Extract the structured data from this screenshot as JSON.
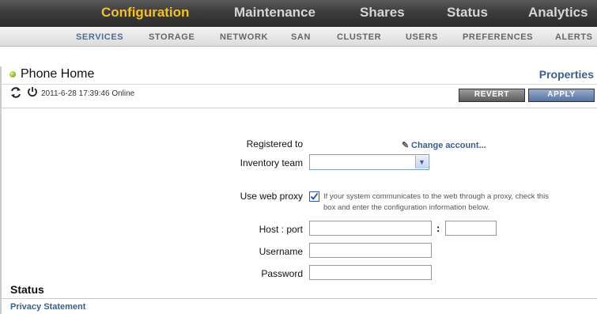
{
  "top_nav": {
    "items": [
      {
        "label": "Configuration",
        "active": true
      },
      {
        "label": "Maintenance",
        "active": false
      },
      {
        "label": "Shares",
        "active": false
      },
      {
        "label": "Status",
        "active": false
      },
      {
        "label": "Analytics",
        "active": false
      }
    ]
  },
  "sub_nav": {
    "items": [
      {
        "label": "SERVICES",
        "active": true
      },
      {
        "label": "STORAGE",
        "active": false
      },
      {
        "label": "NETWORK",
        "active": false
      },
      {
        "label": "SAN",
        "active": false
      },
      {
        "label": "CLUSTER",
        "active": false
      },
      {
        "label": "USERS",
        "active": false
      },
      {
        "label": "PREFERENCES",
        "active": false
      },
      {
        "label": "ALERTS",
        "active": false
      }
    ]
  },
  "page": {
    "title": "Phone Home",
    "properties_link": "Properties",
    "status_info": "2011-6-28 17:39:46 Online",
    "revert_label": "REVERT",
    "apply_label": "APPLY"
  },
  "form": {
    "registered_label": "Registered to",
    "change_account_label": "Change account...",
    "inventory_label": "Inventory team",
    "inventory_value": "",
    "web_proxy_label": "Use web proxy",
    "web_proxy_checked": true,
    "web_proxy_description": "If your system communicates to the web through a proxy, check this box and enter the configuration information below.",
    "host_port_label": "Host : port",
    "host_value": "",
    "port_separator": ":",
    "port_value": "",
    "username_label": "Username",
    "username_value": "",
    "password_label": "Password",
    "password_value": ""
  },
  "footer": {
    "status_heading": "Status",
    "privacy_link": "Privacy Statement"
  },
  "colors": {
    "active_tab": "#f2c02a",
    "link": "#3d5f8c",
    "online_indicator": "#8cc024"
  },
  "icons": [
    "refresh-icon",
    "power-icon",
    "pencil-icon",
    "chevron-down-icon",
    "checkmark-icon"
  ]
}
